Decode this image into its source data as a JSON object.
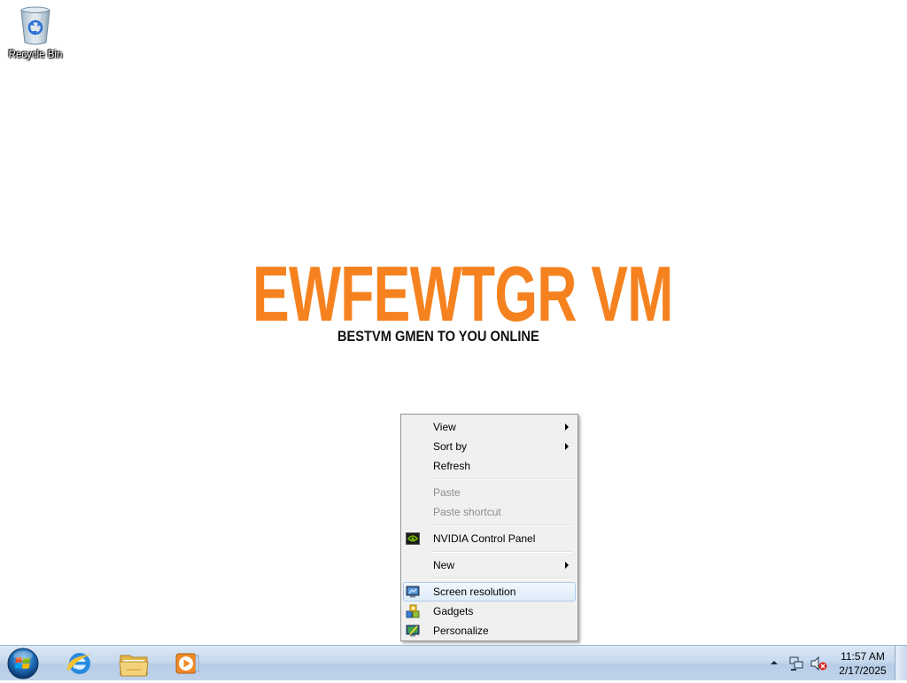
{
  "desktop": {
    "icons": [
      {
        "label": "Recycle Bin",
        "icon": "recycle-bin-icon"
      }
    ],
    "wallpaper": {
      "title": "EWFEWTGR VM",
      "subtitle": "BESTVM GMEN TO YOU ONLINE",
      "title_color": "#f5821f"
    }
  },
  "context_menu": {
    "items": [
      {
        "label": "View",
        "submenu": true
      },
      {
        "label": "Sort by",
        "submenu": true
      },
      {
        "label": "Refresh"
      },
      {
        "label": "Paste",
        "disabled": true
      },
      {
        "label": "Paste shortcut",
        "disabled": true
      },
      {
        "label": "NVIDIA Control Panel",
        "icon": "nvidia-icon"
      },
      {
        "label": "New",
        "submenu": true
      },
      {
        "label": "Screen resolution",
        "icon": "monitor-icon",
        "highlighted": true
      },
      {
        "label": "Gadgets",
        "icon": "gadgets-icon"
      },
      {
        "label": "Personalize",
        "icon": "personalize-icon"
      }
    ]
  },
  "taskbar": {
    "pinned": [
      {
        "name": "Internet Explorer",
        "icon": "internet-explorer-icon"
      },
      {
        "name": "Windows Explorer",
        "icon": "folder-icon"
      },
      {
        "name": "Windows Media Player",
        "icon": "media-player-icon"
      }
    ],
    "tray": {
      "time": "11:57 AM",
      "date": "2/17/2025",
      "network_status": "connected",
      "volume_status": "muted"
    }
  }
}
